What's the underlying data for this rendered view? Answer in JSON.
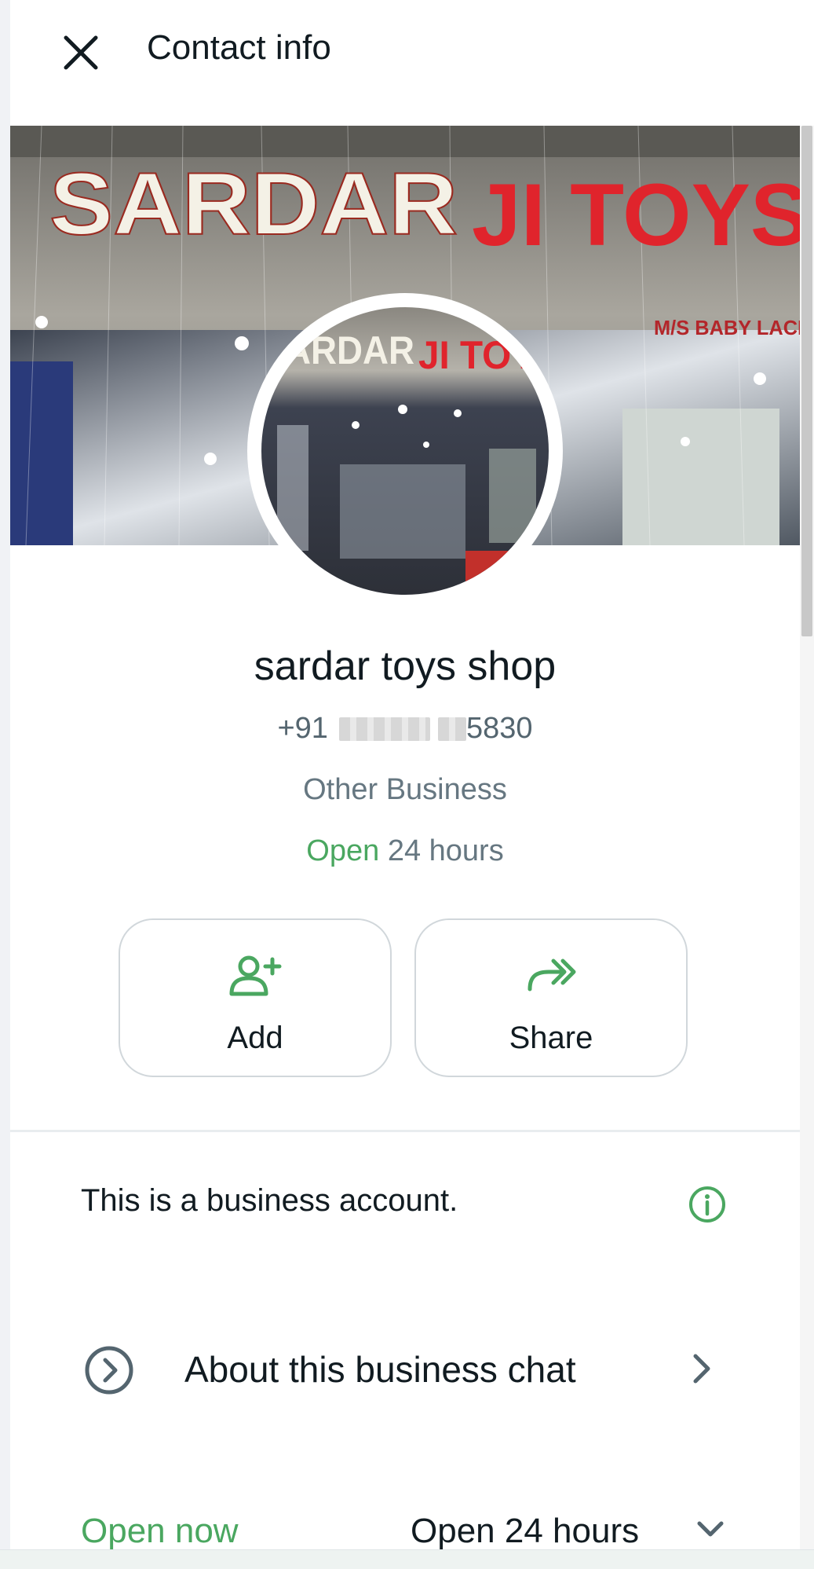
{
  "header": {
    "title": "Contact info",
    "close_icon": "close-icon"
  },
  "cover": {
    "sign_text_white": "SARDAR",
    "sign_text_red": "JI TOYS",
    "sign_subtext": "M/S BABY LACE",
    "colors": {
      "sign_red": "#e0242c",
      "sign_white": "#f4f1e6",
      "facade": "#8f8d86"
    }
  },
  "avatar": {
    "sign_text_white": "ARDAR",
    "sign_text_red": "JI TOY"
  },
  "profile": {
    "name": "sardar toys shop",
    "phone_prefix": "+91",
    "phone_suffix": "5830",
    "category": "Other Business",
    "open_label": "Open",
    "hours_label": "24 hours"
  },
  "actions": [
    {
      "label": "Add",
      "icon": "add-contact-icon"
    },
    {
      "label": "Share",
      "icon": "share-forward-icon"
    }
  ],
  "business_notice": {
    "text": "This is a business account.",
    "icon": "info-icon"
  },
  "about": {
    "label": "About this business chat",
    "icon": "chat-chevron-circle-icon"
  },
  "hours_row": {
    "status": "Open now",
    "value": "Open 24 hours"
  },
  "colors": {
    "accent_green": "#4aa760",
    "text_primary": "#111b21",
    "text_secondary": "#667781"
  }
}
